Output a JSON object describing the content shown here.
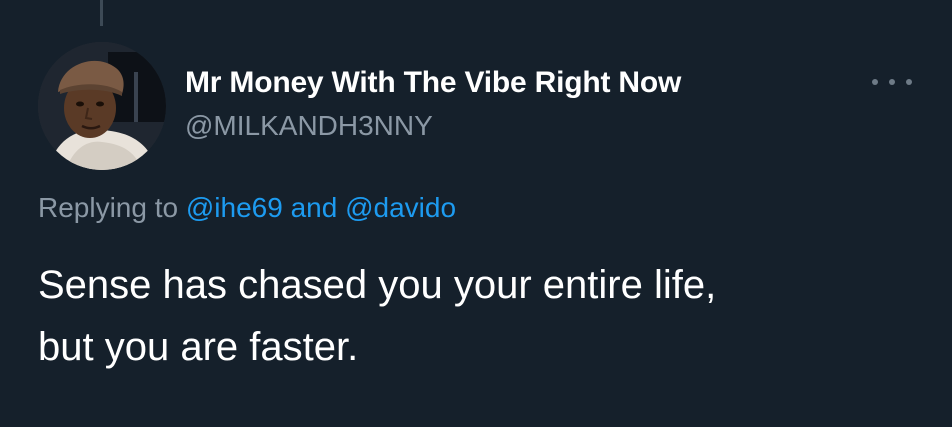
{
  "tweet": {
    "display_name": "Mr Money With The Vibe Right Now",
    "handle": "@MILKANDH3NNY",
    "replying_prefix": "Replying to",
    "replying_to": [
      "@ihe69",
      "@davido"
    ],
    "replying_joiner": "and",
    "text_lines": [
      "Sense has chased you your entire life,",
      "but you are faster."
    ]
  },
  "icons": {
    "more": "more-horizontal-icon"
  },
  "colors": {
    "background": "#15202b",
    "link": "#1d9bf0",
    "secondary_text": "#8b98a5"
  }
}
